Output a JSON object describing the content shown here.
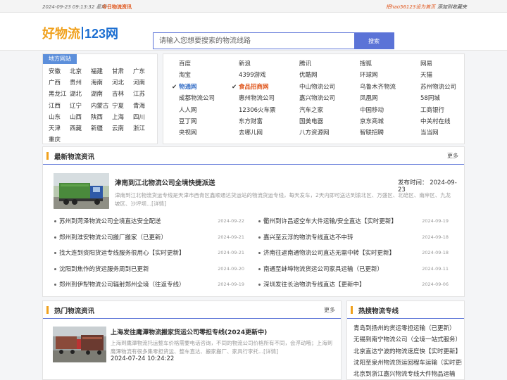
{
  "topbar": {
    "datetime": "2024-09-23 09:13:32 星期一",
    "today_link": "今日物流资讯",
    "set_home": "把hao56123设为首页",
    "add_fav": "添加到收藏夹"
  },
  "header": {
    "logo_part1": "好物流",
    "logo_part2": "123网",
    "search_placeholder": "请输入您想要搜索的物流线路",
    "search_button": "搜索"
  },
  "regions": {
    "tag": "地方网站",
    "items": [
      "安徽",
      "北京",
      "福建",
      "甘肃",
      "广东",
      "广西",
      "贵州",
      "海南",
      "河北",
      "河南",
      "黑龙江",
      "湖北",
      "湖南",
      "吉林",
      "江苏",
      "江西",
      "辽宁",
      "内蒙古",
      "宁夏",
      "青海",
      "山东",
      "山西",
      "陕西",
      "上海",
      "四川",
      "天津",
      "西藏",
      "新疆",
      "云南",
      "浙江",
      "重庆"
    ]
  },
  "links": {
    "items": [
      {
        "label": "百度",
        "style": ""
      },
      {
        "label": "新浪",
        "style": ""
      },
      {
        "label": "腾讯",
        "style": ""
      },
      {
        "label": "搜狐",
        "style": ""
      },
      {
        "label": "网易",
        "style": ""
      },
      {
        "label": "淘宝",
        "style": ""
      },
      {
        "label": "4399游戏",
        "style": ""
      },
      {
        "label": "优酷网",
        "style": ""
      },
      {
        "label": "环球网",
        "style": ""
      },
      {
        "label": "天猫",
        "style": ""
      },
      {
        "label": "物通网",
        "style": "blue"
      },
      {
        "label": "食品招商网",
        "style": "orange"
      },
      {
        "label": "中山物流公司",
        "style": ""
      },
      {
        "label": "乌鲁木齐物流",
        "style": ""
      },
      {
        "label": "苏州物流公司",
        "style": ""
      },
      {
        "label": "成都物流公司",
        "style": ""
      },
      {
        "label": "惠州物流公司",
        "style": ""
      },
      {
        "label": "嘉兴物流公司",
        "style": ""
      },
      {
        "label": "凤凰网",
        "style": ""
      },
      {
        "label": "58同城",
        "style": ""
      },
      {
        "label": "人人网",
        "style": ""
      },
      {
        "label": "12306火车票",
        "style": ""
      },
      {
        "label": "汽车之家",
        "style": ""
      },
      {
        "label": "中国移动",
        "style": ""
      },
      {
        "label": "工商银行",
        "style": ""
      },
      {
        "label": "豆丁网",
        "style": ""
      },
      {
        "label": "东方财富",
        "style": ""
      },
      {
        "label": "国美电器",
        "style": ""
      },
      {
        "label": "京东商城",
        "style": ""
      },
      {
        "label": "中关村在线",
        "style": ""
      },
      {
        "label": "央视网",
        "style": ""
      },
      {
        "label": "去哪儿网",
        "style": ""
      },
      {
        "label": "八方资源网",
        "style": ""
      },
      {
        "label": "智联招聘",
        "style": ""
      },
      {
        "label": "当当网",
        "style": ""
      }
    ]
  },
  "news": {
    "title": "最新物流资讯",
    "more": "更多",
    "featured": {
      "title": "津南到江北物流公司全境快捷派送",
      "time": "发布时间：  2024-09-23",
      "desc": "津南到江北物流货运专线是天津市西青区鑫顺通达货运站的物流货运专线，每天发车，2天内即可送达到渝北区、万盛区、北碚区、南岸区、九龙坡区、沙坪坝...[详情]"
    },
    "left": [
      {
        "title": "苏州到菏泽物流公司全境直达安全配送",
        "date": "2024-09-22"
      },
      {
        "title": "郑州到淮安物流公司搬厂搬家（已更新）",
        "date": "2024-09-21"
      },
      {
        "title": "找大连到资阳货运专线服务很用心【实时更新】",
        "date": "2024-09-21"
      },
      {
        "title": "沈阳到焦作的货运服务周到已更新",
        "date": "2024-09-20"
      },
      {
        "title": "郑州到伊犁物流公司辐射郑州全境（往返专线）",
        "date": "2024-09-19"
      }
    ],
    "right": [
      {
        "title": "衢州到许昌返空车大件运输/安全直达【实时更新】",
        "date": "2024-09-19"
      },
      {
        "title": "嘉兴至云浮的物流专线直达不中转",
        "date": "2024-09-18"
      },
      {
        "title": "济南往返南通物流公司直达无需中转【实时更新】",
        "date": "2024-09-18"
      },
      {
        "title": "南通至蚌埠物流货运公司家具运输（已更新）",
        "date": "2024-09-11"
      },
      {
        "title": "深圳发往长治物流专线直达【更新中】",
        "date": "2024-09-06"
      }
    ]
  },
  "hot": {
    "title": "热门物流资讯",
    "more": "更多",
    "item_title": "上海发往鹰潭物流搬家货运公司零担专线(2024更新中)",
    "item_desc": "上海到鹰潭物流托运整车价格需要电话咨询，不同的物流公司价格所有不同，会浮动哦；上海到鹰潭物流有很多集零担货运、整车直达、搬家搬厂、家具行李托...[详情]",
    "item_time": "2024-07-24 10:24:22"
  },
  "side": {
    "title": "热搜物流专线",
    "items": [
      "青岛到扬州的货运零担运输（已更新）",
      "无锡到南宁物流公司（全境一站式服务）",
      "北京直达宁波的物流速度快【实时更新】",
      "沈阳至泉州物流货运回程车运输（实时更新）",
      "北京到浙江嘉兴物流专线大件物品运输"
    ]
  },
  "colors": {
    "accent": "#5b73d7",
    "brand_orange": "#f0a11d",
    "link_blue": "#3d74c9",
    "link_orange": "#e0581f"
  }
}
